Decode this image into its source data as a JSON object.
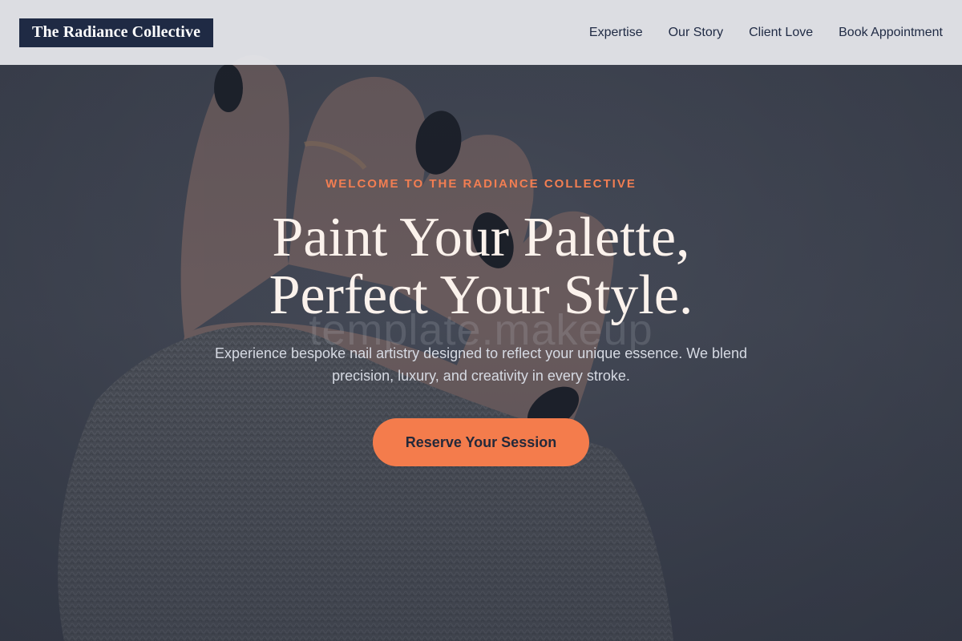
{
  "header": {
    "logo_text": "The Radiance Collective",
    "nav": [
      {
        "label": "Expertise"
      },
      {
        "label": "Our Story"
      },
      {
        "label": "Client Love"
      },
      {
        "label": "Book Appointment"
      }
    ]
  },
  "hero": {
    "eyebrow": "WELCOME TO THE RADIANCE COLLECTIVE",
    "headline_line1": "Paint Your Palette,",
    "headline_line2": "Perfect Your Style.",
    "watermark": "template.makeup",
    "subtext": "Experience bespoke nail artistry designed to reflect your unique essence. We blend precision, luxury, and creativity in every stroke.",
    "cta_label": "Reserve Your Session"
  },
  "colors": {
    "accent": "#f47c4c",
    "brand_navy": "#1f2a44",
    "header_bg": "#e8eaee",
    "headline": "#fbf2ec"
  }
}
